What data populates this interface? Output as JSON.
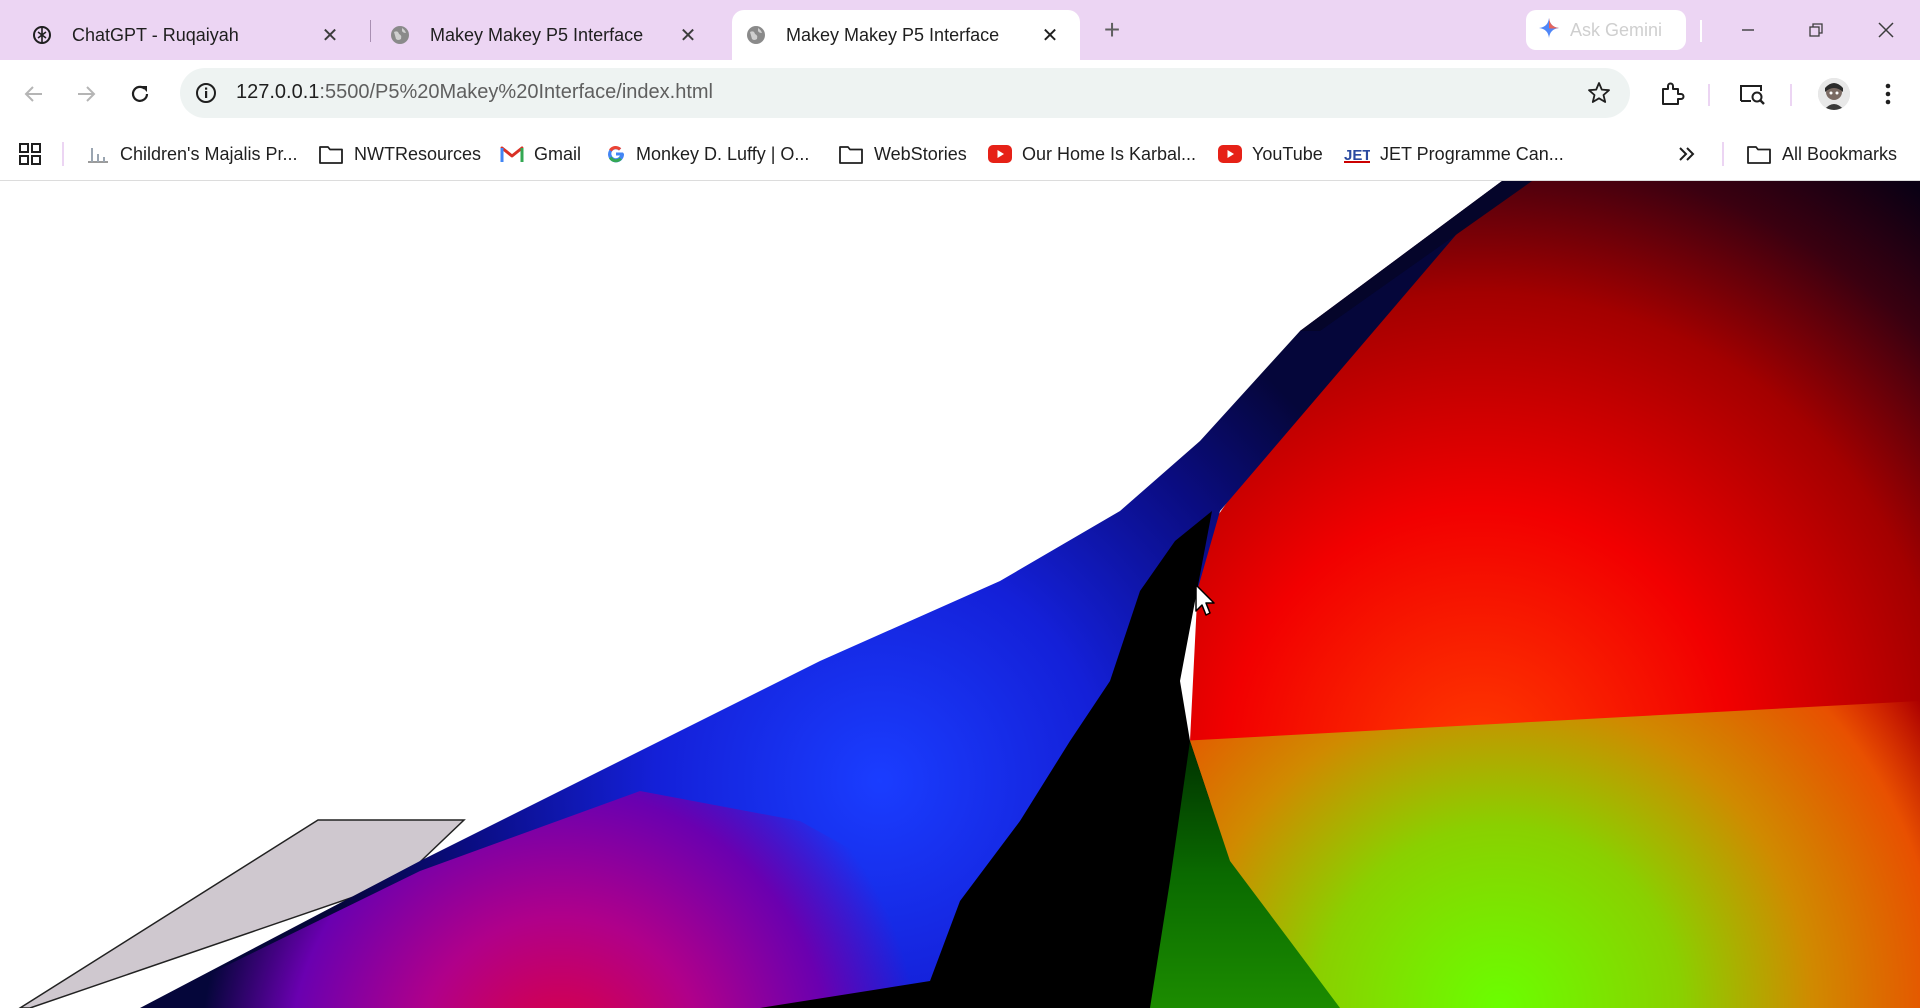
{
  "tabs": [
    {
      "title": "ChatGPT - Ruqaiyah",
      "favicon": "openai-icon",
      "active": false
    },
    {
      "title": "Makey Makey P5 Interface",
      "favicon": "globe-icon",
      "active": false
    },
    {
      "title": "Makey Makey P5 Interface",
      "favicon": "globe-icon",
      "active": true
    }
  ],
  "gemini": {
    "label": "Ask Gemini"
  },
  "address": {
    "host": "127.0.0.1",
    "path": ":5500/P5%20Makey%20Interface/index.html"
  },
  "bookmarks": [
    {
      "label": "Children's Majalis Pr...",
      "icon": "bar-chart-icon"
    },
    {
      "label": "NWTResources",
      "icon": "folder-icon"
    },
    {
      "label": "Gmail",
      "icon": "gmail-icon"
    },
    {
      "label": "Monkey D. Luffy | O...",
      "icon": "google-icon"
    },
    {
      "label": "WebStories",
      "icon": "folder-icon"
    },
    {
      "label": "Our Home Is Karbal...",
      "icon": "youtube-icon"
    },
    {
      "label": "YouTube",
      "icon": "youtube-icon"
    },
    {
      "label": "JET Programme Can...",
      "icon": "jet-icon"
    }
  ],
  "all_bookmarks": {
    "label": "All Bookmarks"
  },
  "colors": {
    "tabstrip": "#ecd5f3",
    "omnibox": "#eef3f2",
    "youtube_red": "#e62117"
  }
}
